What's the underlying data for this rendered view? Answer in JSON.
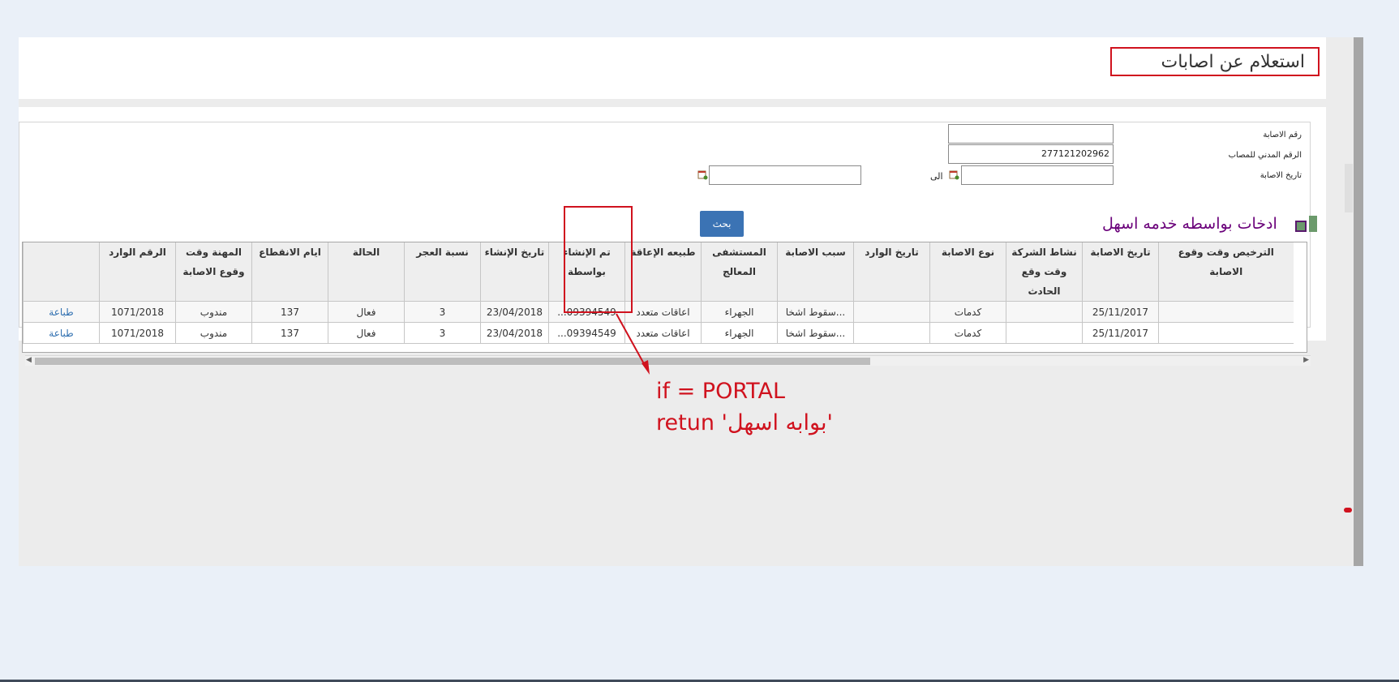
{
  "page_title": "استعلام عن اصابات",
  "form": {
    "injury_no_label": "رقم الاصابة",
    "injury_no_value": "",
    "civil_id_label": "الرقم المدني للمصاب",
    "civil_id_value": "277121202962",
    "injury_date_label": "تاريخ الاصابة",
    "injury_date_from": "",
    "to_label": "الى",
    "injury_date_to": "",
    "search_button": "بحث",
    "eshal_label": "ادخات بواسطه خدمه اسهل"
  },
  "table": {
    "headers": [
      "الترخيص وقت وقوع الاصابة",
      "تاريخ الاصابة",
      "نشاط الشركة وقت وقع الحادث",
      "نوع الاصابة",
      "تاريخ الوارد",
      "سبب الاصابة",
      "المستشفى المعالج",
      "طبيعه الإعاقة",
      "تم الإنشاء بواسطة",
      "تاريخ الإنشاء",
      "نسبة العجر",
      "الحالة",
      "ايام الانقطاع",
      "المهنة وقت وقوع الاصابة",
      "الرقم الوارد",
      ""
    ],
    "rows": [
      [
        "",
        "25/11/2017",
        "",
        "كدمات",
        "",
        "سقوط اشخا...",
        "الجهراء",
        "اعاقات متعدد",
        "...09394549",
        "23/04/2018",
        "3",
        "فعال",
        "137",
        "مندوب",
        "1071/2018",
        "طباعة"
      ],
      [
        "",
        "25/11/2017",
        "",
        "كدمات",
        "",
        "سقوط اشخا...",
        "الجهراء",
        "اعاقات متعدد",
        "...09394549",
        "23/04/2018",
        "3",
        "فعال",
        "137",
        "مندوب",
        "1071/2018",
        "طباعة"
      ]
    ]
  },
  "annotation": {
    "line1": "if = PORTAL",
    "line2": "retun 'بوابه اسهل'"
  }
}
